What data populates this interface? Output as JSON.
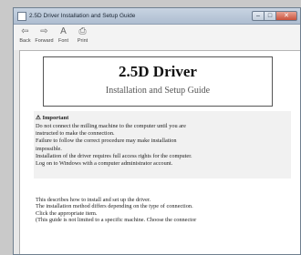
{
  "window": {
    "title": "2.5D Driver Installation and Setup Guide",
    "controls": {
      "minimize": "–",
      "maximize": "□",
      "close": "✕"
    }
  },
  "toolbar": [
    {
      "label": "Back",
      "icon": "arrow-left-icon",
      "glyph": "⇦"
    },
    {
      "label": "Forward",
      "icon": "arrow-right-icon",
      "glyph": "⇨"
    },
    {
      "label": "Font",
      "icon": "font-icon",
      "glyph": "A"
    },
    {
      "label": "Print",
      "icon": "printer-icon",
      "glyph": "⎙"
    }
  ],
  "document": {
    "title": "2.5D Driver",
    "subtitle": "Installation and Setup Guide",
    "important": {
      "icon": "⚠",
      "heading": "Important",
      "lines": [
        "Do not connect the milling machine to the computer until you are",
        "instructed to make the connection.",
        "Failure to follow the correct procedure may make installation",
        "impossible.",
        "Installation of the driver requires full access rights for the computer.",
        "Log on to Windows with a computer administrator account."
      ]
    },
    "body_lines": [
      "This describes how to install and set up the driver.",
      "The installation method differs depending on the type of connection.",
      "Click the appropriate item.",
      "(This guide is not limited to a specific machine. Choose the connector"
    ]
  }
}
